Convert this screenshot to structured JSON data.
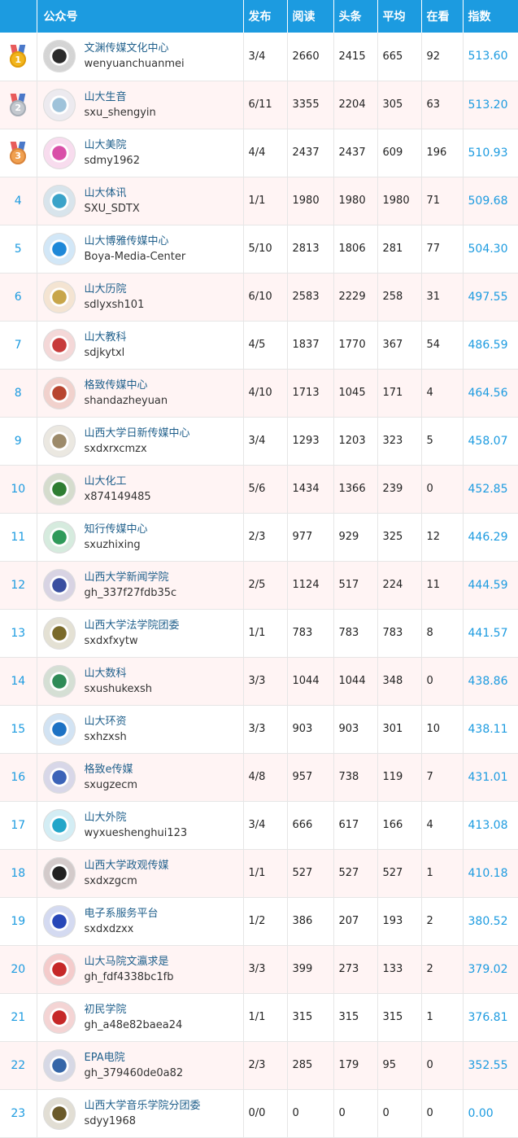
{
  "header": {
    "account": "公众号",
    "publish": "发布",
    "reads": "阅读",
    "headline": "头条",
    "average": "平均",
    "watching": "在看",
    "index": "指数"
  },
  "rows": [
    {
      "rank": "1",
      "name": "文渊传媒文化中心",
      "id": "wenyuanchuanmei",
      "publish": "3/4",
      "reads": "2660",
      "headline": "2415",
      "average": "665",
      "watching": "92",
      "index": "513.60"
    },
    {
      "rank": "2",
      "name": "山大生音",
      "id": "sxu_shengyin",
      "publish": "6/11",
      "reads": "3355",
      "headline": "2204",
      "average": "305",
      "watching": "63",
      "index": "513.20"
    },
    {
      "rank": "3",
      "name": "山大美院",
      "id": "sdmy1962",
      "publish": "4/4",
      "reads": "2437",
      "headline": "2437",
      "average": "609",
      "watching": "196",
      "index": "510.93"
    },
    {
      "rank": "4",
      "name": "山大体讯",
      "id": "SXU_SDTX",
      "publish": "1/1",
      "reads": "1980",
      "headline": "1980",
      "average": "1980",
      "watching": "71",
      "index": "509.68"
    },
    {
      "rank": "5",
      "name": "山大博雅传媒中心",
      "id": "Boya-Media-Center",
      "publish": "5/10",
      "reads": "2813",
      "headline": "1806",
      "average": "281",
      "watching": "77",
      "index": "504.30"
    },
    {
      "rank": "6",
      "name": "山大历院",
      "id": "sdlyxsh101",
      "publish": "6/10",
      "reads": "2583",
      "headline": "2229",
      "average": "258",
      "watching": "31",
      "index": "497.55"
    },
    {
      "rank": "7",
      "name": "山大教科",
      "id": "sdjkytxl",
      "publish": "4/5",
      "reads": "1837",
      "headline": "1770",
      "average": "367",
      "watching": "54",
      "index": "486.59"
    },
    {
      "rank": "8",
      "name": "格致传媒中心",
      "id": "shandazheyuan",
      "publish": "4/10",
      "reads": "1713",
      "headline": "1045",
      "average": "171",
      "watching": "4",
      "index": "464.56"
    },
    {
      "rank": "9",
      "name": "山西大学日新传媒中心",
      "id": "sxdxrxcmzx",
      "publish": "3/4",
      "reads": "1293",
      "headline": "1203",
      "average": "323",
      "watching": "5",
      "index": "458.07"
    },
    {
      "rank": "10",
      "name": "山大化工",
      "id": "x874149485",
      "publish": "5/6",
      "reads": "1434",
      "headline": "1366",
      "average": "239",
      "watching": "0",
      "index": "452.85"
    },
    {
      "rank": "11",
      "name": "知行传媒中心",
      "id": "sxuzhixing",
      "publish": "2/3",
      "reads": "977",
      "headline": "929",
      "average": "325",
      "watching": "12",
      "index": "446.29"
    },
    {
      "rank": "12",
      "name": "山西大学新闻学院",
      "id": "gh_337f27fdb35c",
      "publish": "2/5",
      "reads": "1124",
      "headline": "517",
      "average": "224",
      "watching": "11",
      "index": "444.59"
    },
    {
      "rank": "13",
      "name": "山西大学法学院团委",
      "id": "sxdxfxytw",
      "publish": "1/1",
      "reads": "783",
      "headline": "783",
      "average": "783",
      "watching": "8",
      "index": "441.57"
    },
    {
      "rank": "14",
      "name": "山大数科",
      "id": "sxushukexsh",
      "publish": "3/3",
      "reads": "1044",
      "headline": "1044",
      "average": "348",
      "watching": "0",
      "index": "438.86"
    },
    {
      "rank": "15",
      "name": "山大环资",
      "id": "sxhzxsh",
      "publish": "3/3",
      "reads": "903",
      "headline": "903",
      "average": "301",
      "watching": "10",
      "index": "438.11"
    },
    {
      "rank": "16",
      "name": "格致e传媒",
      "id": "sxugzecm",
      "publish": "4/8",
      "reads": "957",
      "headline": "738",
      "average": "119",
      "watching": "7",
      "index": "431.01"
    },
    {
      "rank": "17",
      "name": "山大外院",
      "id": "wyxueshenghui123",
      "publish": "3/4",
      "reads": "666",
      "headline": "617",
      "average": "166",
      "watching": "4",
      "index": "413.08"
    },
    {
      "rank": "18",
      "name": "山西大学政观传媒",
      "id": "sxdxzgcm",
      "publish": "1/1",
      "reads": "527",
      "headline": "527",
      "average": "527",
      "watching": "1",
      "index": "410.18"
    },
    {
      "rank": "19",
      "name": "电子系服务平台",
      "id": "sxdxdzxx",
      "publish": "1/2",
      "reads": "386",
      "headline": "207",
      "average": "193",
      "watching": "2",
      "index": "380.52"
    },
    {
      "rank": "20",
      "name": "山大马院文瀛求是",
      "id": "gh_fdf4338bc1fb",
      "publish": "3/3",
      "reads": "399",
      "headline": "273",
      "average": "133",
      "watching": "2",
      "index": "379.02"
    },
    {
      "rank": "21",
      "name": "初民学院",
      "id": "gh_a48e82baea24",
      "publish": "1/1",
      "reads": "315",
      "headline": "315",
      "average": "315",
      "watching": "1",
      "index": "376.81"
    },
    {
      "rank": "22",
      "name": "EPA电院",
      "id": "gh_379460de0a82",
      "publish": "2/3",
      "reads": "285",
      "headline": "179",
      "average": "95",
      "watching": "0",
      "index": "352.55"
    },
    {
      "rank": "23",
      "name": "山西大学音乐学院分团委",
      "id": "sdyy1968",
      "publish": "0/0",
      "reads": "0",
      "headline": "0",
      "average": "0",
      "watching": "0",
      "index": "0.00"
    }
  ],
  "avatar_colors": [
    "#2b2b2b",
    "#9fc3da",
    "#d94fa8",
    "#3aa3c9",
    "#1e88d8",
    "#c8a64a",
    "#c73b3b",
    "#b8452f",
    "#9c8a6a",
    "#2e7d32",
    "#2f9a5a",
    "#3a4fa0",
    "#7a6a2a",
    "#2e8b57",
    "#1d72c4",
    "#3b63b8",
    "#23a6c9",
    "#222222",
    "#2747b8",
    "#c62828",
    "#c62828",
    "#3566a8",
    "#6b5a2a"
  ]
}
